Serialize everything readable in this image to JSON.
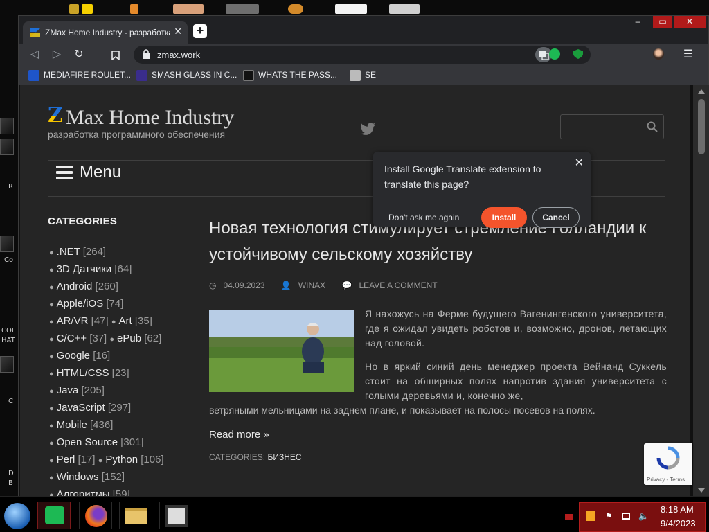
{
  "browser": {
    "tab_title": "ZMax Home Industry - разработка программного обеспечения",
    "url": "zmax.work",
    "bookmarks": [
      {
        "label": "MEDIAFIRE ROULET...",
        "icon": "mediafire-icon"
      },
      {
        "label": "SMASH GLASS IN C...",
        "icon": "smash-glass-icon"
      },
      {
        "label": "WHATS THE PASS...",
        "icon": "lock-site-icon"
      },
      {
        "label": "SE",
        "icon": "bookmark-site-icon"
      }
    ]
  },
  "translate_popup": {
    "message": "Install Google Translate extension to translate this page?",
    "dont_ask": "Don't ask me again",
    "install": "Install",
    "cancel": "Cancel"
  },
  "site": {
    "logo_letter": "Z",
    "title": "Max Home Industry",
    "subtitle": "разработка программного обеспечения",
    "menu": "Menu"
  },
  "sidebar": {
    "heading": "CATEGORIES",
    "rows": [
      [
        {
          "name": ".NET",
          "count": "[264]"
        }
      ],
      [
        {
          "name": "3D Датчики",
          "count": "[64]"
        }
      ],
      [
        {
          "name": "Android",
          "count": "[260]"
        }
      ],
      [
        {
          "name": "Apple/iOS",
          "count": "[74]"
        }
      ],
      [
        {
          "name": "AR/VR",
          "count": "[47]"
        },
        {
          "name": "Art",
          "count": "[35]"
        }
      ],
      [
        {
          "name": "C/C++",
          "count": "[37]"
        },
        {
          "name": "ePub",
          "count": "[62]"
        }
      ],
      [
        {
          "name": "Google",
          "count": "[16]"
        }
      ],
      [
        {
          "name": "HTML/CSS",
          "count": "[23]"
        }
      ],
      [
        {
          "name": "Java",
          "count": "[205]"
        }
      ],
      [
        {
          "name": "JavaScript",
          "count": "[297]"
        }
      ],
      [
        {
          "name": "Mobile",
          "count": "[436]"
        }
      ],
      [
        {
          "name": "Open Source",
          "count": "[301]"
        }
      ],
      [
        {
          "name": "Perl",
          "count": "[17]"
        },
        {
          "name": "Python",
          "count": "[106]"
        }
      ],
      [
        {
          "name": "Windows",
          "count": "[152]"
        }
      ],
      [
        {
          "name": "Алгоритмы",
          "count": "[59]"
        }
      ]
    ]
  },
  "post": {
    "title": "Новая технология стимулирует стремление Голландии к устойчивому сельскому хозяйству",
    "date": "04.09.2023",
    "author": "WINAX",
    "comment": "LEAVE A COMMENT",
    "para1": "Я нахожусь на Ферме будущего Вагенингенского университета, где я ожидал увидеть роботов и, возможно, дронов, летающих над головой.",
    "para2_a": "Но в яркий синий день менеджер проекта Вейнанд Суккель стоит на обширных полях напротив здания университета с голыми деревьями и, конечно же,",
    "para2_b": "ветряными мельницами на заднем плане, и показывает на полосы посевов на полях.",
    "read_more": "Read more »",
    "categories_label": "CATEGORIES:",
    "category": "БИЗНЕС"
  },
  "recaptcha": {
    "privacy": "Privacy",
    "terms": "Terms"
  },
  "desktop_labels": [
    "R",
    "Co",
    "COI",
    "HAT",
    "C",
    "D",
    "B"
  ],
  "tray": {
    "time": "8:18 AM",
    "date": "9/4/2023"
  },
  "colors": {
    "accent_install": "#f4542c",
    "logo_blue": "#1f6fd6",
    "logo_yellow": "#f5c400",
    "tray_bg": "#7a0f0f"
  }
}
